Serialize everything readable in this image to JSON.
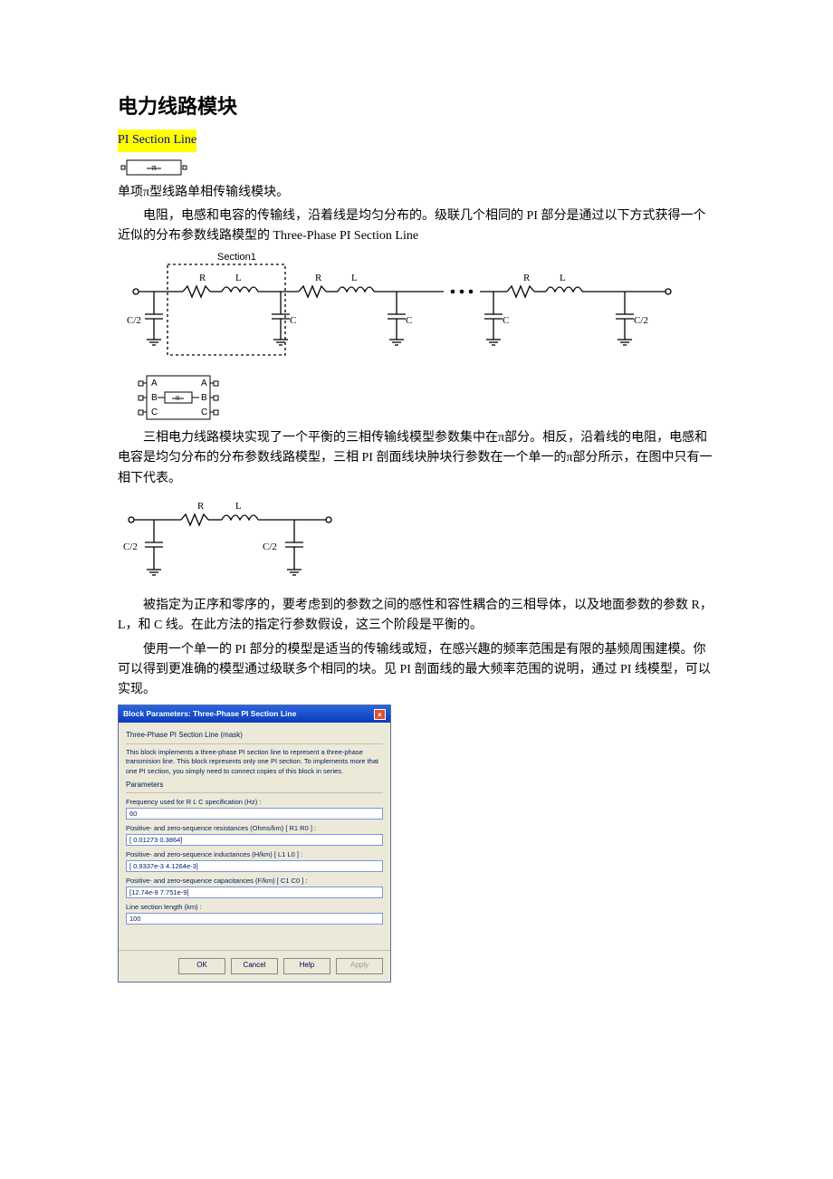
{
  "title": "电力线路模块",
  "highlight": "PI Section Line",
  "para1": "单项π型线路单相传输线模块。",
  "para2": "电阻，电感和电容的传输线，沿着线是均匀分布的。级联几个相同的 PI 部分是通过以下方式获得一个近似的分布参数线路模型的 Three-Phase PI Section Line",
  "diagram1": {
    "section": "Section1",
    "R": "R",
    "L": "L",
    "C": "C",
    "C2": "C/2"
  },
  "miniBlock": {
    "A": "A",
    "B": "B",
    "C": "C"
  },
  "para3": "三相电力线路模块实现了一个平衡的三相传输线模型参数集中在π部分。相反，沿着线的电阻，电感和电容是均匀分布的分布参数线路模型，三相 PI 剖面线块肿块行参数在一个单一的π部分所示，在图中只有一相下代表。",
  "diagram2": {
    "R": "R",
    "L": "L",
    "C2": "C/2"
  },
  "para4": "被指定为正序和零序的，要考虑到的参数之间的感性和容性耦合的三相导体，以及地面参数的参数 R，L，和 C 线。在此方法的指定行参数假设，这三个阶段是平衡的。",
  "para5": "使用一个单一的 PI 部分的模型是适当的传输线或短，在感兴趣的频率范围是有限的基频周围建模。你可以得到更准确的模型通过级联多个相同的块。见 PI 剖面线的最大频率范围的说明，通过 PI 线模型，可以实现。",
  "dialog": {
    "title": "Block Parameters: Three-Phase PI Section Line",
    "mask": "Three-Phase PI Section Line (mask)",
    "desc": "This block implements a three-phase PI section line to represent a three-phase transmision line. This block represents only one PI section. To implements more that one PI section, you simply need to connect copies of this block in series.",
    "paramsHeader": "Parameters",
    "fields": [
      {
        "label": "Frequency used for R L C specification (Hz) :",
        "value": "60"
      },
      {
        "label": "Positive- and zero-sequence resistances (Ohms/km) [ R1  R0 ] :",
        "value": "[ 0.01273 0.3864]"
      },
      {
        "label": "Positive- and zero-sequence inductances (H/km) [ L1  L0 ] :",
        "value": "[ 0.9337e-3 4.1264e-3]"
      },
      {
        "label": "Positive- and zero-sequence capacitances (F/km) [ C1 C0 ] :",
        "value": "[12.74e-9 7.751e-9]"
      },
      {
        "label": "Line section length (km) :",
        "value": "100"
      }
    ],
    "buttons": {
      "ok": "OK",
      "cancel": "Cancel",
      "help": "Help",
      "apply": "Apply"
    }
  }
}
